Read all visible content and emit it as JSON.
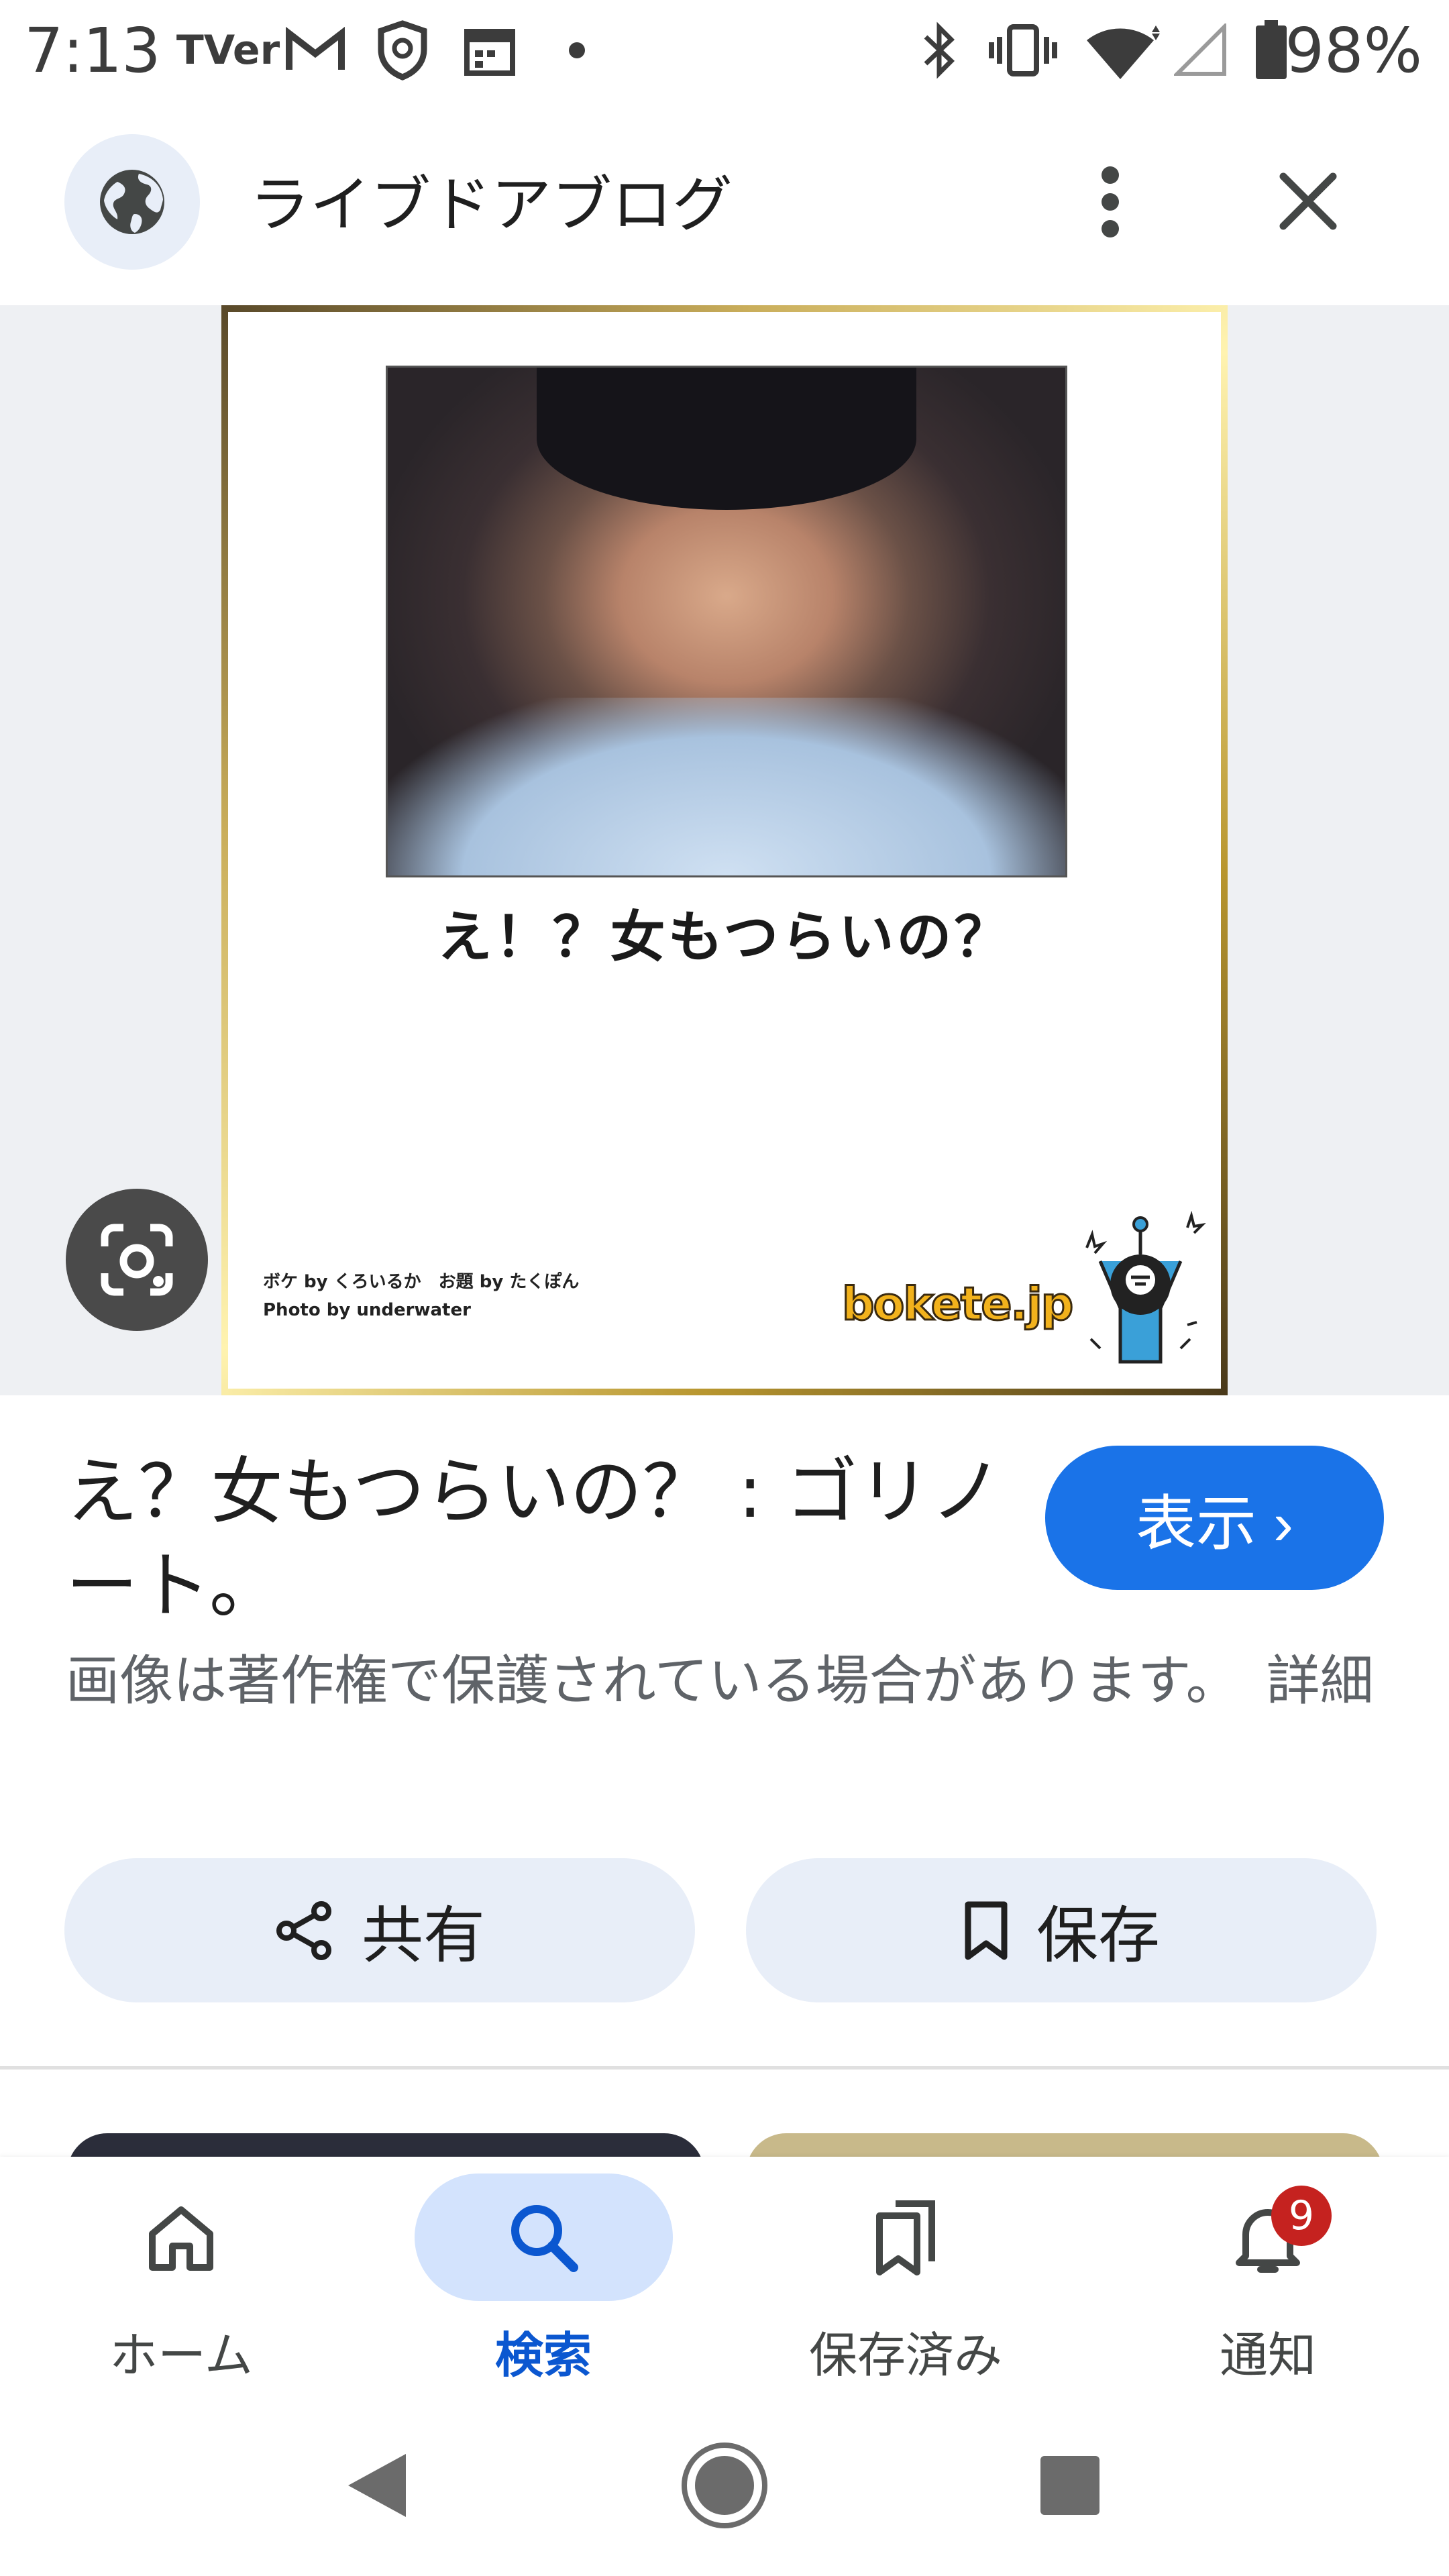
{
  "status_bar": {
    "time": "7:13",
    "tver_label": "TVer",
    "battery_percent": "98%"
  },
  "header": {
    "site_name": "ライブドアブログ"
  },
  "image": {
    "caption": "え！？女もつらいの？",
    "credit_line_1": "ボケ by くろいるか　お題 by たくぽん",
    "credit_line_2": "Photo by underwater",
    "logo_text": "bokete.jp"
  },
  "result": {
    "title": "え？女もつらいの？ : ゴリノート。",
    "view_button": "表示 ›",
    "copyright_notice": "画像は著作権で保護されている場合があります。",
    "details_link": "詳細"
  },
  "actions": {
    "share_label": "共有",
    "save_label": "保存"
  },
  "bottom_nav": {
    "items": [
      {
        "label": "ホーム",
        "icon": "home-icon"
      },
      {
        "label": "検索",
        "icon": "search-icon"
      },
      {
        "label": "保存済み",
        "icon": "collections-icon"
      },
      {
        "label": "通知",
        "icon": "bell-icon"
      }
    ],
    "active_index": 1,
    "notification_count": "9"
  },
  "colors": {
    "accent": "#1a73e8",
    "active_nav_bg": "#d3e3fd",
    "badge": "#c5221f"
  }
}
